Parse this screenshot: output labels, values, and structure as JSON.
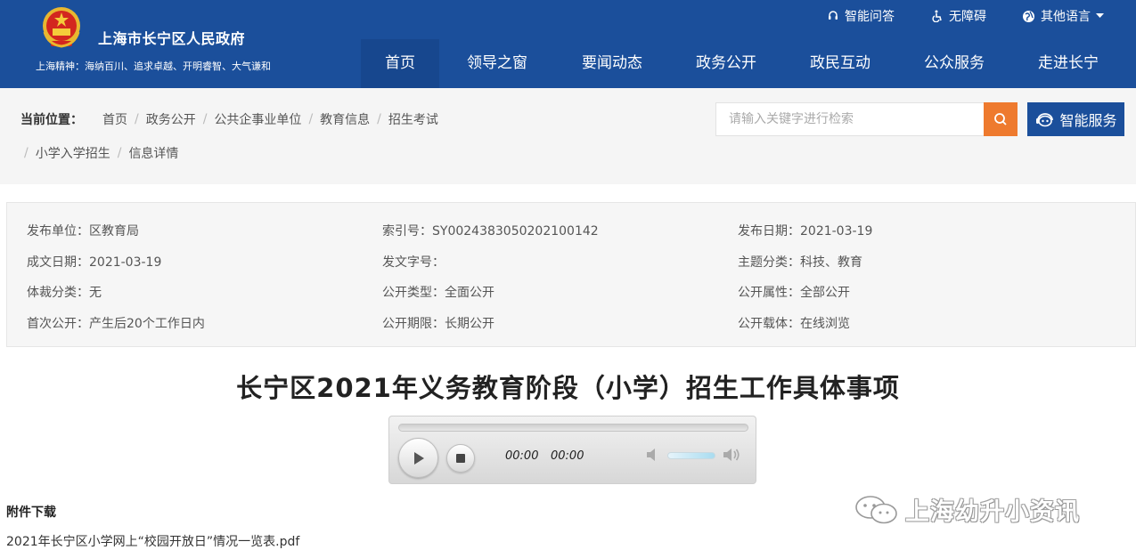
{
  "header": {
    "site_name": "上海市长宁区人民政府",
    "spirit": "上海精神：海纳百川、追求卓越、开明睿智、大气谦和",
    "utilities": [
      {
        "label": "智能问答",
        "icon": "headset-icon"
      },
      {
        "label": "无障碍",
        "icon": "accessibility-icon"
      },
      {
        "label": "其他语言",
        "icon": "globe-icon"
      }
    ],
    "nav": [
      "首页",
      "领导之窗",
      "要闻动态",
      "政务公开",
      "政民互动",
      "公众服务",
      "走进长宁"
    ],
    "active_nav": "首页",
    "brand_color": "#1b4f9b"
  },
  "breadcrumb": {
    "label": "当前位置：",
    "items": [
      "首页",
      "政务公开",
      "公共企事业单位",
      "教育信息",
      "招生考试",
      "小学入学招生",
      "信息详情"
    ]
  },
  "search": {
    "placeholder": "请输入关键字进行检索",
    "button_color": "#ee7a2e"
  },
  "smart_service": {
    "label": "智能服务"
  },
  "meta": {
    "publisher": "发布单位：区教育局",
    "index_no": "索引号：SY0024383050202100142",
    "publish_date": "发布日期：2021-03-19",
    "written_date": "成文日期：2021-03-19",
    "doc_no": "发文字号：",
    "topic": "主题分类：科技、教育",
    "genre": "体裁分类：无",
    "open_type": "公开类型：全面公开",
    "open_attr": "公开属性：全部公开",
    "first_open": "首次公开：产生后20个工作日内",
    "open_period": "公开期限：长期公开",
    "open_carrier": "公开载体：在线浏览"
  },
  "article": {
    "title": "长宁区2021年义务教育阶段（小学）招生工作具体事项"
  },
  "player": {
    "current_time": "00:00",
    "duration": "00:00",
    "progress": 0,
    "volume": 0.8
  },
  "attachments": {
    "heading": "附件下载",
    "files": [
      "2021年长宁区小学网上“校园开放日”情况一览表.pdf"
    ]
  },
  "watermark": {
    "text": "上海幼升小资讯",
    "icon": "wechat-icon"
  }
}
